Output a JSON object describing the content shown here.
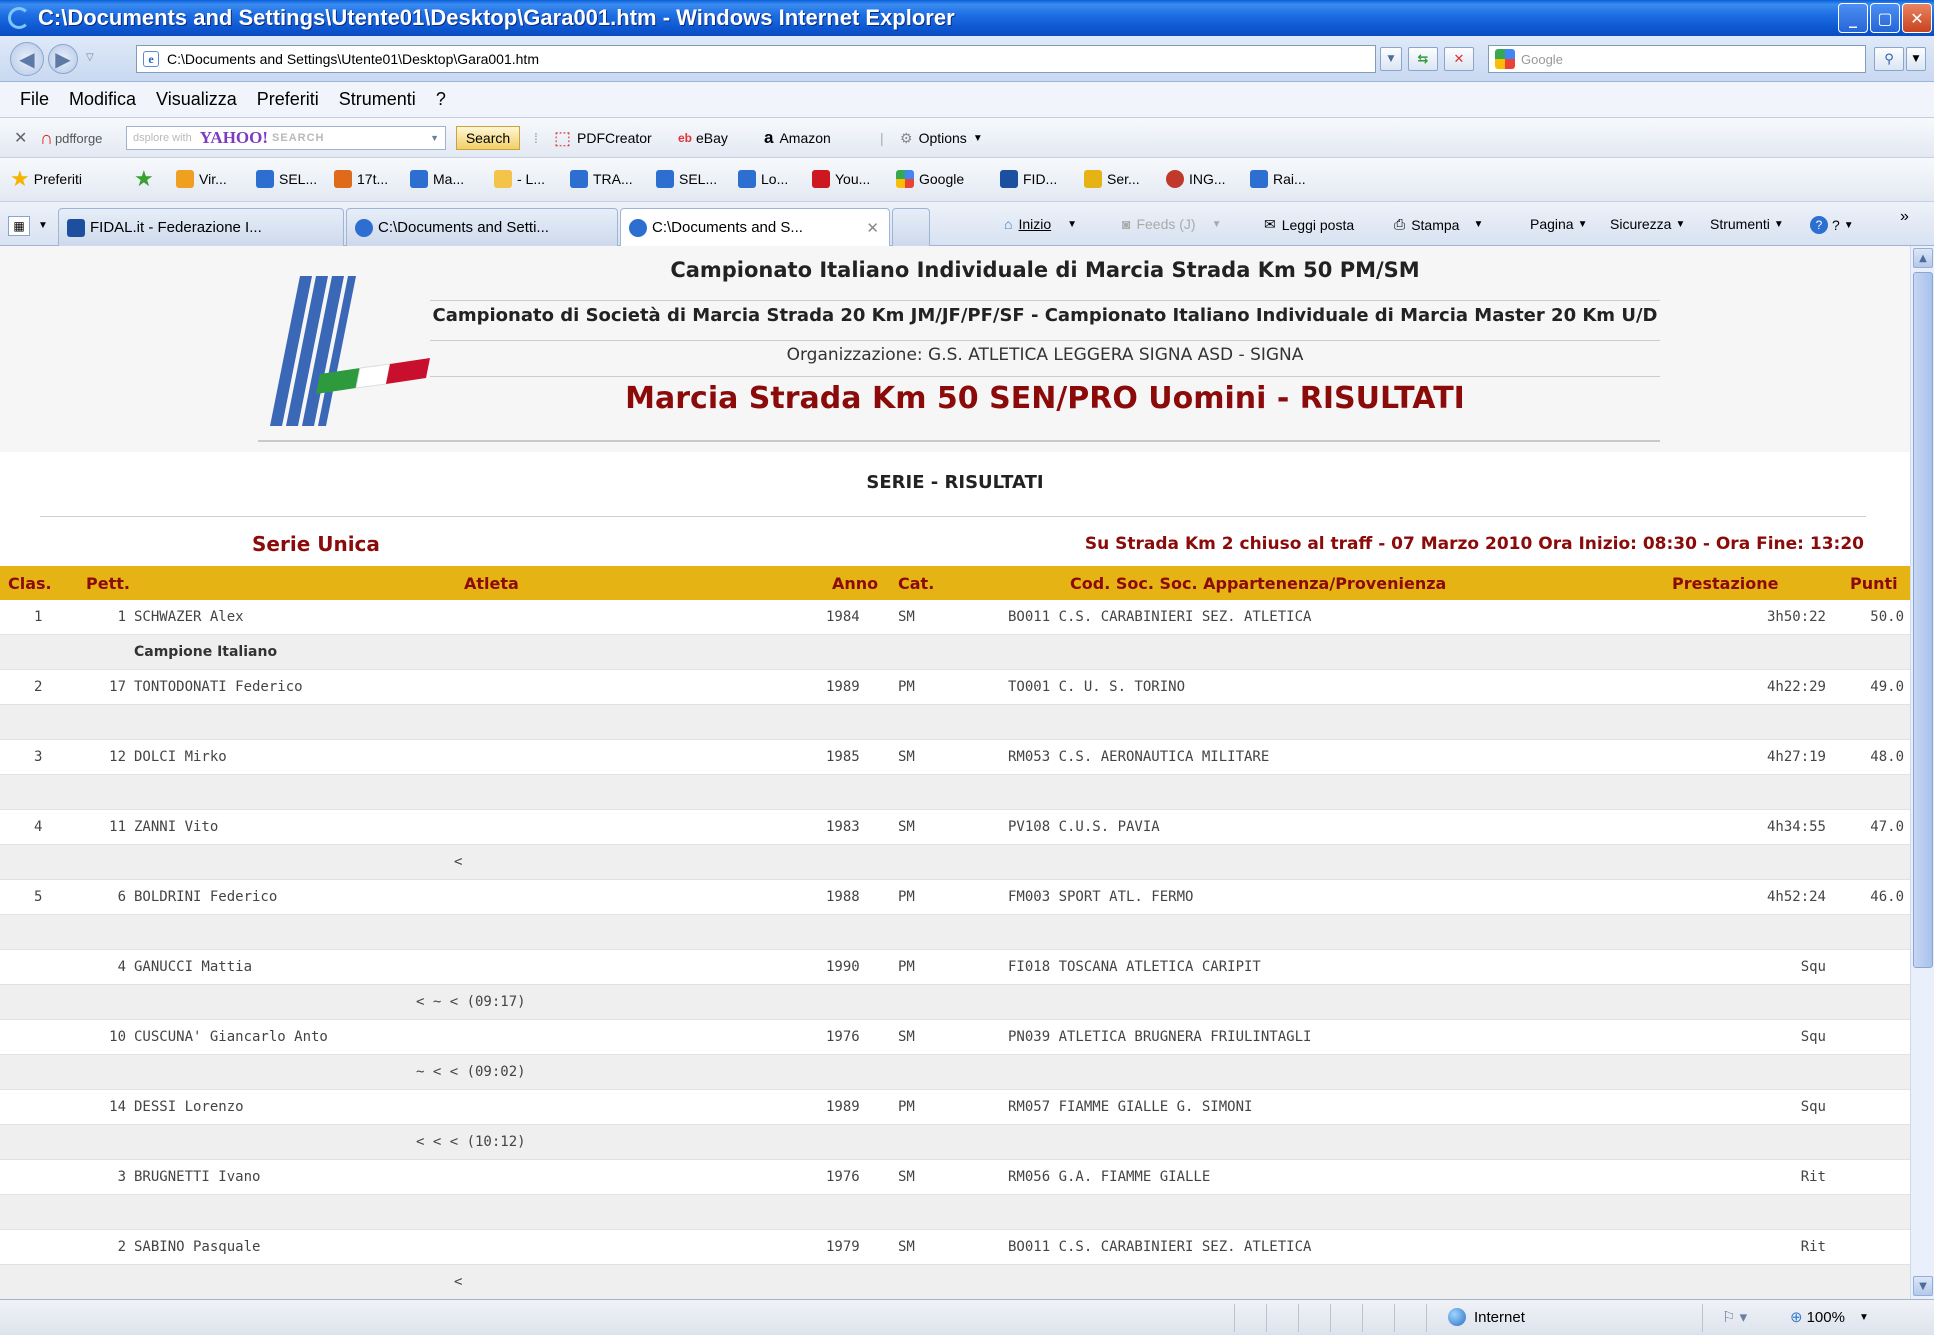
{
  "window": {
    "title": "C:\\Documents and Settings\\Utente01\\Desktop\\Gara001.htm - Windows Internet Explorer"
  },
  "address": {
    "url": "C:\\Documents and Settings\\Utente01\\Desktop\\Gara001.htm",
    "search_placeholder": "Google"
  },
  "menu": [
    "File",
    "Modifica",
    "Visualizza",
    "Preferiti",
    "Strumenti",
    "?"
  ],
  "toolbar": {
    "pdfforge": "pdfforge",
    "yahoo_prefix": "dsplore with",
    "yahoo_brand": "YAHOO!",
    "yahoo_suffix": "SEARCH",
    "search_label": "Search",
    "pdfcreator": "PDFCreator",
    "ebay": "eBay",
    "amazon": "Amazon",
    "options": "Options"
  },
  "favorites": {
    "label": "Preferiti",
    "items": [
      "Vir...",
      "SEL...",
      "17t...",
      "Ma...",
      "- L...",
      "TRA...",
      "SEL...",
      "Lo...",
      "You...",
      "Google",
      "FID...",
      "Ser...",
      "ING...",
      "Rai..."
    ]
  },
  "tabs": [
    {
      "label": "FIDAL.it - Federazione I..."
    },
    {
      "label": "C:\\Documents and Setti..."
    },
    {
      "label": "C:\\Documents and S..."
    }
  ],
  "commands": {
    "home": "Inizio",
    "feeds": "Feeds (J)",
    "mail": "Leggi posta",
    "print": "Stampa",
    "page": "Pagina",
    "safety": "Sicurezza",
    "tools": "Strumenti",
    "help": "?"
  },
  "page": {
    "line1": "Campionato Italiano Individuale di Marcia Strada Km 50 PM/SM",
    "line2": "Campionato di Società di Marcia Strada 20 Km JM/JF/PF/SF - Campionato Italiano Individuale di Marcia Master 20 Km U/D",
    "line3": "Organizzazione: G.S. ATLETICA LEGGERA SIGNA ASD - SIGNA",
    "line4": "Marcia Strada Km 50 SEN/PRO Uomini - RISULTATI",
    "serie_title": "SERIE - RISULTATI",
    "serie_name": "Serie Unica",
    "serie_info": "Su Strada Km 2 chiuso al traff - 07 Marzo 2010 Ora Inizio: 08:30 - Ora Fine: 13:20"
  },
  "table": {
    "headers": {
      "clas": "Clas.",
      "pett": "Pett.",
      "atleta": "Atleta",
      "anno": "Anno",
      "cat": "Cat.",
      "soc": "Cod. Soc. Soc. Appartenenza/Provenienza",
      "prest": "Prestazione",
      "punti": "Punti"
    },
    "rows": [
      {
        "clas": "1",
        "pett": "1",
        "name": "SCHWAZER Alex",
        "anno": "1984",
        "cat": "SM",
        "soc": "BO011 C.S. CARABINIERI SEZ. ATLETICA",
        "prest": "3h50:22",
        "punti": "50.0",
        "note": "Campione Italiano",
        "penalty": ""
      },
      {
        "clas": "2",
        "pett": "17",
        "name": "TONTODONATI Federico",
        "anno": "1989",
        "cat": "PM",
        "soc": "TO001 C. U. S. TORINO",
        "prest": "4h22:29",
        "punti": "49.0",
        "note": "",
        "penalty": ""
      },
      {
        "clas": "3",
        "pett": "12",
        "name": "DOLCI Mirko",
        "anno": "1985",
        "cat": "SM",
        "soc": "RM053 C.S. AERONAUTICA MILITARE",
        "prest": "4h27:19",
        "punti": "48.0",
        "note": "",
        "penalty": ""
      },
      {
        "clas": "4",
        "pett": "11",
        "name": "ZANNI Vito",
        "anno": "1983",
        "cat": "SM",
        "soc": "PV108 C.U.S. PAVIA",
        "prest": "4h34:55",
        "punti": "47.0",
        "note": "",
        "penalty": "<"
      },
      {
        "clas": "5",
        "pett": "6",
        "name": "BOLDRINI Federico",
        "anno": "1988",
        "cat": "PM",
        "soc": "FM003 SPORT ATL. FERMO",
        "prest": "4h52:24",
        "punti": "46.0",
        "note": "",
        "penalty": ""
      },
      {
        "clas": "",
        "pett": "4",
        "name": "GANUCCI Mattia",
        "anno": "1990",
        "cat": "PM",
        "soc": "FI018 TOSCANA ATLETICA CARIPIT",
        "prest": "Squ",
        "punti": "",
        "note": "",
        "penalty": "< ~ < (09:17)"
      },
      {
        "clas": "",
        "pett": "10",
        "name": "CUSCUNA' Giancarlo Anto",
        "anno": "1976",
        "cat": "SM",
        "soc": "PN039 ATLETICA BRUGNERA FRIULINTAGLI",
        "prest": "Squ",
        "punti": "",
        "note": "",
        "penalty": "~ < < (09:02)"
      },
      {
        "clas": "",
        "pett": "14",
        "name": "DESSI Lorenzo",
        "anno": "1989",
        "cat": "PM",
        "soc": "RM057 FIAMME GIALLE G. SIMONI",
        "prest": "Squ",
        "punti": "",
        "note": "",
        "penalty": "< < < (10:12)"
      },
      {
        "clas": "",
        "pett": "3",
        "name": "BRUGNETTI Ivano",
        "anno": "1976",
        "cat": "SM",
        "soc": "RM056 G.A. FIAMME GIALLE",
        "prest": "Rit",
        "punti": "",
        "note": "",
        "penalty": ""
      },
      {
        "clas": "",
        "pett": "2",
        "name": "SABINO Pasquale",
        "anno": "1979",
        "cat": "SM",
        "soc": "BO011 C.S. CARABINIERI SEZ. ATLETICA",
        "prest": "Rit",
        "punti": "",
        "note": "",
        "penalty": "<"
      }
    ]
  },
  "status": {
    "zone": "Internet",
    "zoom": "100%"
  },
  "colors": {
    "header_band": "#e6b314",
    "title_red": "#8b0a0a"
  }
}
